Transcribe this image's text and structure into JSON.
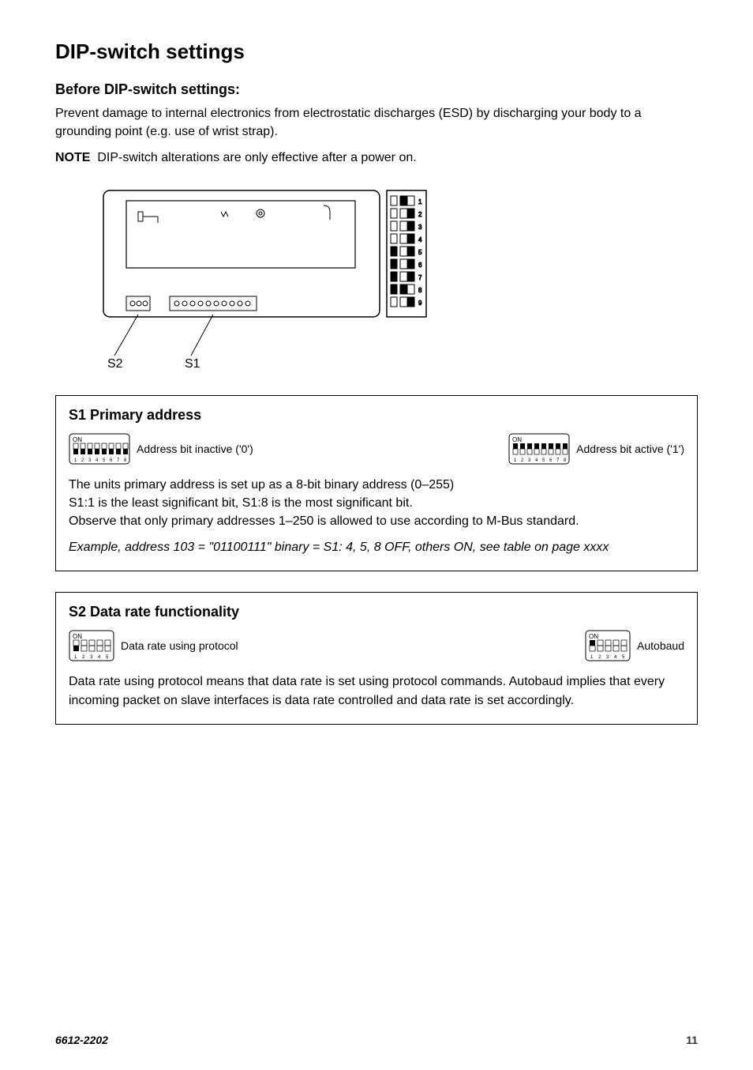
{
  "title": "DIP-switch settings",
  "before_heading": "Before DIP-switch settings:",
  "intro_p1": "Prevent damage to internal electronics from electrostatic discharges (ESD) by discharging your body to a grounding point (e.g. use of wrist strap).",
  "note_label": "NOTE",
  "note_text": "DIP-switch alterations are only effective after a power on.",
  "diagram": {
    "s2": "S2",
    "s1": "S1"
  },
  "box1": {
    "title": "S1 Primary address",
    "sw_inactive_caption": "Address bit inactive ('0')",
    "sw_active_caption": "Address bit active ('1')",
    "body1": "The units primary address is set up as a 8-bit binary address (0–255)",
    "body2": "S1:1 is the least significant bit, S1:8 is the most significant bit.",
    "body3": "Observe that only primary addresses 1–250 is allowed to use according to M-Bus standard.",
    "example": "Example, address 103 = \"01100111\" binary = S1: 4, 5, 8 OFF, others ON, see table on page xxxx"
  },
  "box2": {
    "title": "S2 Data rate functionality",
    "sw_protocol_caption": "Data rate using protocol",
    "sw_autobaud_caption": "Autobaud",
    "body": "Data rate using protocol means that data rate is set using protocol commands. Autobaud implies that every incoming packet on slave interfaces is data rate controlled and data rate is set accordingly."
  },
  "footer": {
    "doc": "6612-2202",
    "page": "11"
  }
}
